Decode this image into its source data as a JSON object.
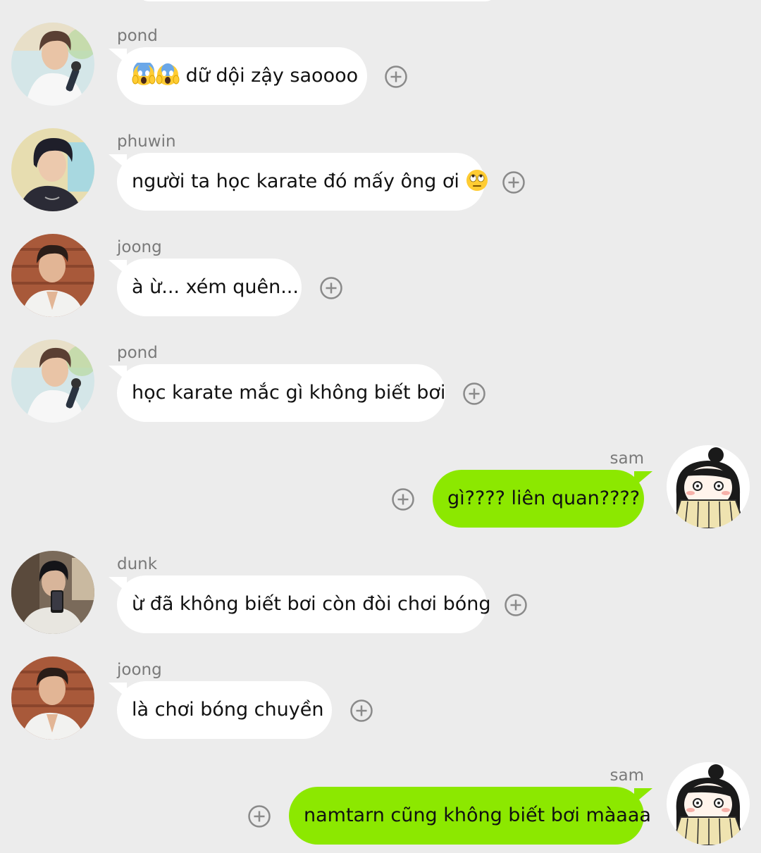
{
  "messages": [
    {
      "sender": "pond",
      "side": "left",
      "avatar": "pond-avatar",
      "prefix_emoji": [
        "screaming-face-emoji",
        "screaming-face-emoji"
      ],
      "text": " dữ dội zậy saoooo",
      "suffix_emoji": []
    },
    {
      "sender": "phuwin",
      "side": "left",
      "avatar": "phuwin-avatar",
      "prefix_emoji": [],
      "text": "người ta học karate đó mấy ông ơi ",
      "suffix_emoji": [
        "eye-roll-emoji"
      ]
    },
    {
      "sender": "joong",
      "side": "left",
      "avatar": "joong-avatar",
      "prefix_emoji": [],
      "text": "à ừ... xém quên...",
      "suffix_emoji": []
    },
    {
      "sender": "pond",
      "side": "left",
      "avatar": "pond-avatar",
      "prefix_emoji": [],
      "text": "học karate mắc gì không biết bơi",
      "suffix_emoji": []
    },
    {
      "sender": "sam",
      "side": "right",
      "avatar": "sam-avatar",
      "prefix_emoji": [],
      "text": "gì???? liên quan????",
      "suffix_emoji": []
    },
    {
      "sender": "dunk",
      "side": "left",
      "avatar": "dunk-avatar",
      "prefix_emoji": [],
      "text": "ừ đã không biết bơi còn đòi chơi bóng",
      "suffix_emoji": []
    },
    {
      "sender": "joong",
      "side": "left",
      "avatar": "joong-avatar",
      "prefix_emoji": [],
      "text": "là chơi bóng chuyền",
      "suffix_emoji": []
    },
    {
      "sender": "sam",
      "side": "right",
      "avatar": "sam-avatar",
      "prefix_emoji": [],
      "text": "namtarn cũng không biết bơi màaaa",
      "suffix_emoji": []
    }
  ],
  "icons": {
    "add_reaction": "plus-circle-icon"
  },
  "colors": {
    "background": "#ececec",
    "incoming_bubble": "#ffffff",
    "outgoing_bubble": "#8ce800",
    "sender_name": "#7a7a7a",
    "icon": "#8a8a8a"
  }
}
